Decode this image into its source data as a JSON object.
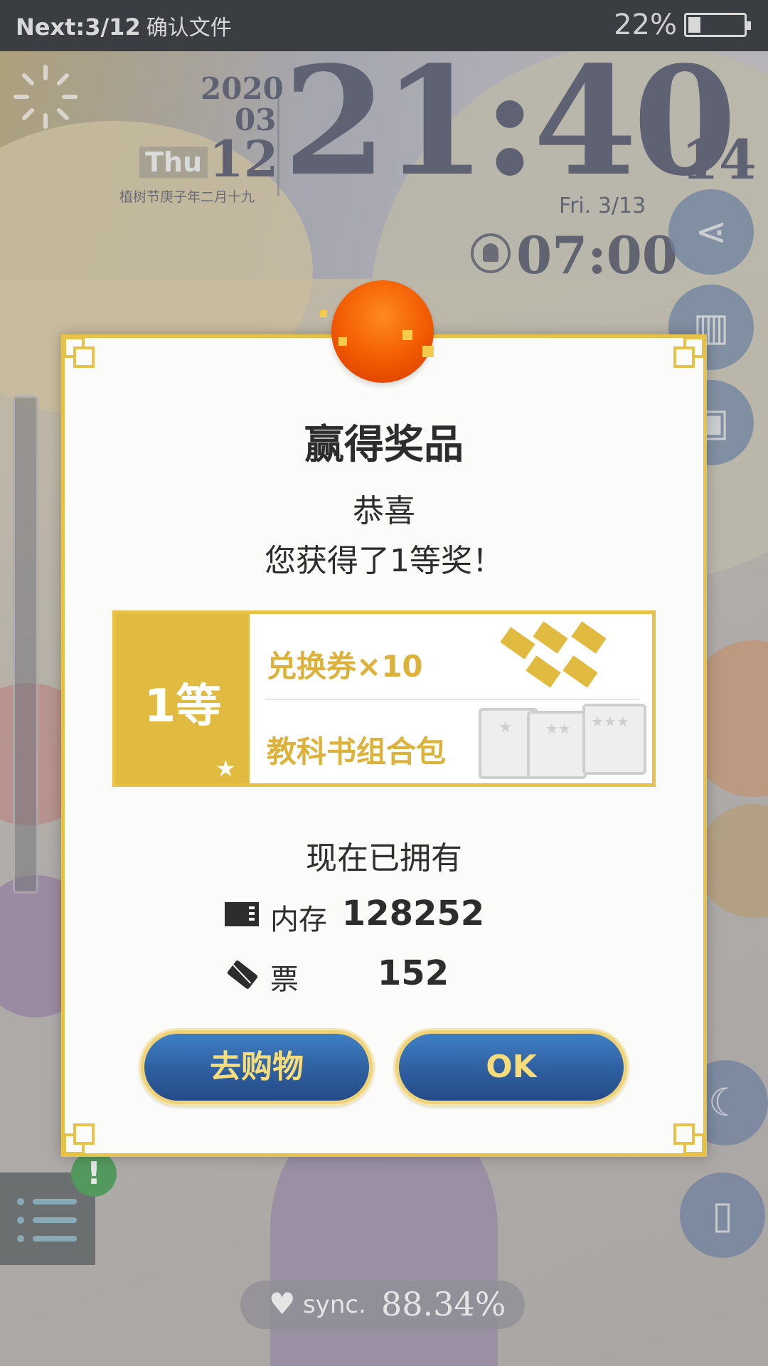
{
  "status_bar": {
    "title": "Next:3/12",
    "title_cn": "确认文件",
    "battery_percent": "22%",
    "battery_level": 0.22
  },
  "clock": {
    "year": "2020",
    "month": "03",
    "day": "12",
    "weekday": "Thu",
    "lunar": "植树节庚子年二月十九",
    "time": "21:40",
    "seconds": "14",
    "next_date": "Fri.  3/13",
    "alarm": "07:00"
  },
  "dialog": {
    "title": "赢得奖品",
    "congrats": "恭喜",
    "message": "您获得了1等奖！",
    "prize": {
      "rank": "1等",
      "item1": "兑换券×10",
      "item2": "教科书组合包"
    },
    "owned_title": "现在已拥有",
    "owned": [
      {
        "icon": "memory-card-icon",
        "label": "内存",
        "value": "128252"
      },
      {
        "icon": "ticket-icon",
        "label": "票",
        "value": "152"
      }
    ],
    "buttons": {
      "shop": "去购物",
      "ok": "OK"
    }
  },
  "sync": {
    "label": "sync.",
    "value": "88.34%"
  },
  "colors": {
    "gold": "#e6c248",
    "prize_gold": "#e1bb40",
    "button_blue": "#2e5fa0",
    "button_text": "#f6dd7a",
    "orb_orange": "#f15a00",
    "status_bar": "#2f3238"
  }
}
